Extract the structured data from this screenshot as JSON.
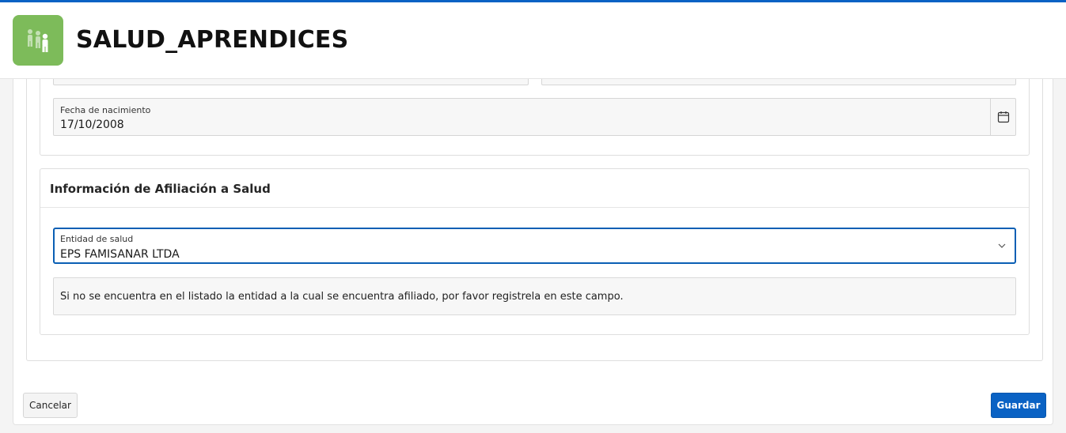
{
  "colors": {
    "accent": "#0a62c4",
    "app_icon_bg": "#7dbb5a",
    "focus_border": "#0a5fb4"
  },
  "header": {
    "app_title": "SALUD_APRENDICES",
    "app_icon": "people-group-icon"
  },
  "personal_info": {
    "birthdate": {
      "label": "Fecha de nacimiento",
      "value": "17/10/2008",
      "icon": "calendar-icon"
    }
  },
  "health_region": {
    "title": "Información de Afiliación a Salud",
    "entity_select": {
      "label": "Entidad de salud",
      "value": "EPS FAMISANAR LTDA",
      "icon": "chevron-down-icon"
    },
    "note_field": {
      "placeholder": "Si no se encuentra en el listado la entidad a la cual se encuentra afiliado, por favor registrela en este campo."
    }
  },
  "footer": {
    "cancel_label": "Cancelar",
    "save_label": "Guardar"
  }
}
